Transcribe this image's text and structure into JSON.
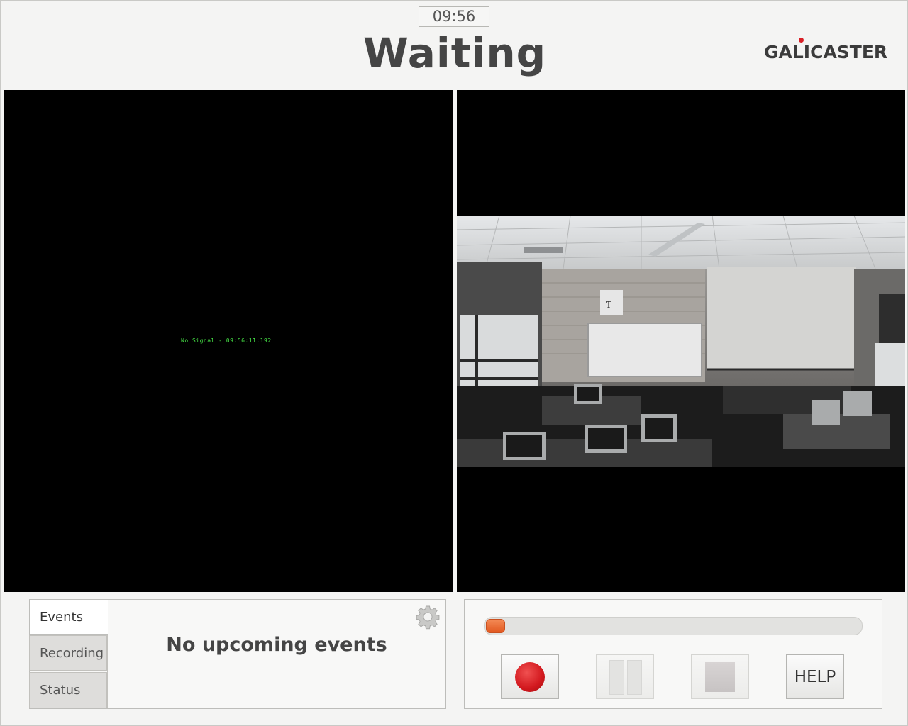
{
  "header": {
    "clock": "09:56",
    "status": "Waiting",
    "logo_text": "GALICASTER"
  },
  "previews": {
    "left": {
      "overlay_text": "No Signal - 09:56:11:192"
    },
    "right": {
      "content": "classroom camera feed"
    }
  },
  "events_panel": {
    "tabs": [
      {
        "label": "Events",
        "active": true
      },
      {
        "label": "Recording",
        "active": false
      },
      {
        "label": "Status",
        "active": false
      }
    ],
    "message": "No upcoming events",
    "settings_icon": "gear-icon"
  },
  "controls": {
    "progress": 0.05,
    "buttons": {
      "record_icon": "record-icon",
      "pause_icon": "pause-icon",
      "stop_icon": "stop-icon",
      "help_label": "HELP"
    }
  },
  "colors": {
    "record": "#d2181e",
    "progress": "#e8642a",
    "logo_dot": "#d91f26",
    "no_signal_text": "#46e346"
  }
}
